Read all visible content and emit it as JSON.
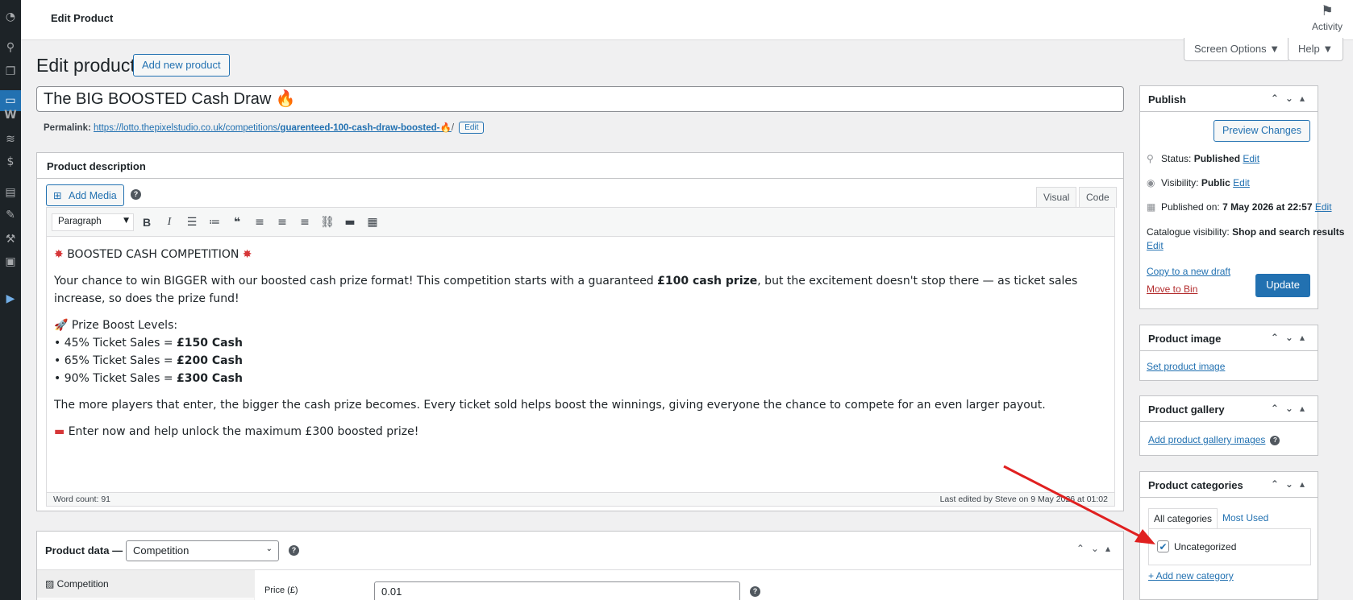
{
  "topbar": {
    "title": "Edit Product",
    "activity_label": "Activity"
  },
  "screen_options": {
    "label": "Screen Options ▼"
  },
  "help": {
    "label": "Help ▼"
  },
  "page": {
    "heading": "Edit product",
    "add_new_label": "Add new product"
  },
  "title_field": {
    "value": "The BIG BOOSTED Cash Draw 🔥"
  },
  "permalink": {
    "label": "Permalink:",
    "url_base": "https://lotto.thepixelstudio.co.uk/competitions/",
    "slug": "guarenteed-100-cash-draw-boosted-🔥",
    "trailing": "/",
    "edit_label": "Edit"
  },
  "description": {
    "heading": "Product description",
    "add_media_label": "Add Media",
    "tabs": {
      "visual": "Visual",
      "code": "Code"
    },
    "format_select": "Paragraph",
    "content": {
      "line1": "BOOSTED CASH COMPETITION",
      "p2_a": "Your chance to win BIGGER with our boosted cash prize format! This competition starts with a guaranteed ",
      "p2_bold": "£100 cash prize",
      "p2_b": ", but the excitement doesn't stop there — as ticket sales increase, so does the prize fund!",
      "levels_title": "Prize Boost Levels:",
      "levels": [
        {
          "prefix": "• 45% Ticket Sales = ",
          "bold": "£150 Cash"
        },
        {
          "prefix": "• 65% Ticket Sales = ",
          "bold": "£200 Cash"
        },
        {
          "prefix": "• 90% Ticket Sales = ",
          "bold": "£300 Cash"
        }
      ],
      "p4": "The more players that enter, the bigger the cash prize becomes. Every ticket sold helps boost the winnings, giving everyone the chance to compete for an even larger payout.",
      "p5": "Enter now and help unlock the maximum £300 boosted prize!"
    },
    "word_count": "Word count: 91",
    "last_edited": "Last edited by Steve on 9 May 2026 at 01:02"
  },
  "product_data": {
    "label": "Product data —",
    "type_select": "Competition",
    "tab_label": "Competition",
    "price_label": "Price (£)",
    "price_value": "0.01"
  },
  "publish": {
    "heading": "Publish",
    "preview_label": "Preview Changes",
    "status_label": "Status:",
    "status_value": "Published",
    "visibility_label": "Visibility:",
    "visibility_value": "Public",
    "published_label": "Published on:",
    "published_value": "7 May 2026 at 22:57",
    "catalogue_label": "Catalogue visibility:",
    "catalogue_value": "Shop and search results",
    "edit_label": "Edit",
    "copy_draft_label": "Copy to a new draft",
    "move_bin_label": "Move to Bin",
    "update_label": "Update"
  },
  "product_image": {
    "heading": "Product image",
    "set_label": "Set product image"
  },
  "product_gallery": {
    "heading": "Product gallery",
    "add_label": "Add product gallery images"
  },
  "product_categories": {
    "heading": "Product categories",
    "tab_all": "All categories",
    "tab_most_used": "Most Used",
    "items": [
      {
        "label": "Uncategorized",
        "checked": true
      }
    ],
    "add_new_label": "+ Add new category"
  },
  "colors": {
    "accent": "#2271b1",
    "sidebar": "#1d2327",
    "annotation_arrow": "#e02020"
  }
}
